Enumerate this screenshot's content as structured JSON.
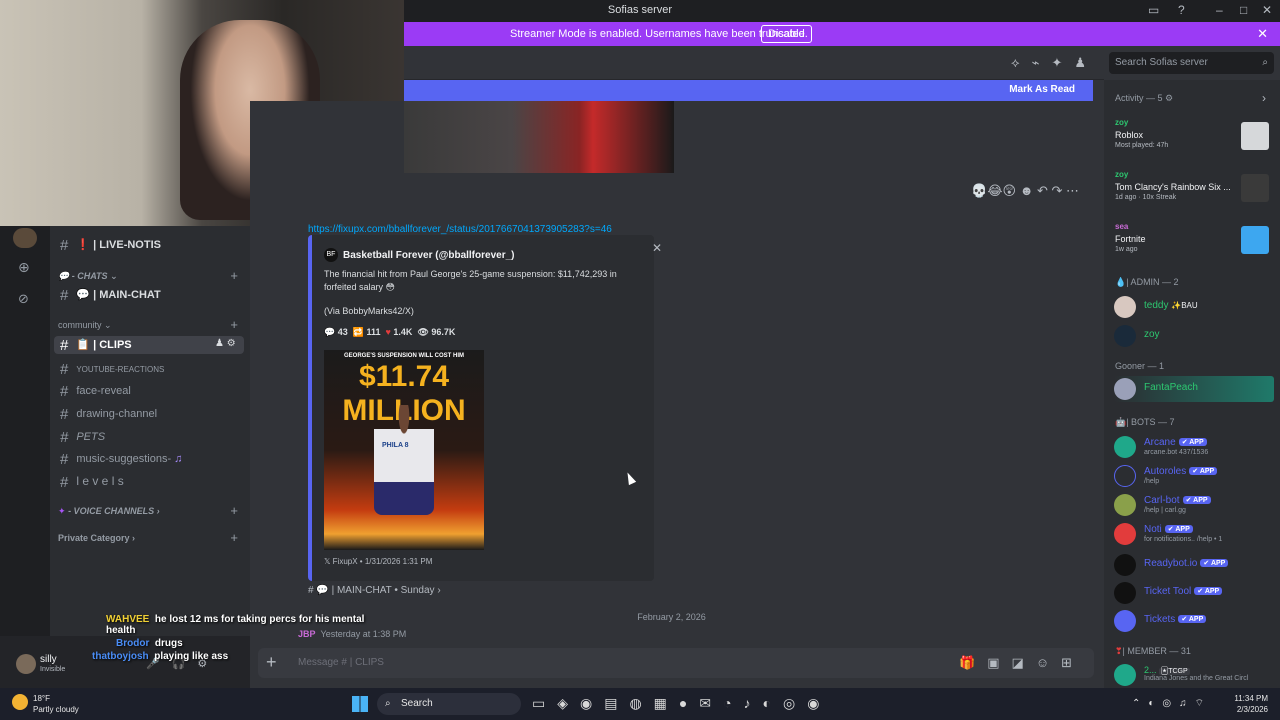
{
  "window": {
    "title": "Sofias server"
  },
  "streamer_banner": {
    "message": "Streamer Mode is enabled. Usernames have been truncated.",
    "button": "Disable"
  },
  "search": {
    "placeholder": "Search Sofias server"
  },
  "mark_read": {
    "label": "Mark As Read"
  },
  "channels": {
    "live_notis": "| LIVE-NOTIS",
    "chats_category": "- CHATS",
    "main_chat": "| MAIN-CHAT",
    "community_category": "community",
    "clips": "| CLIPS",
    "youtube_reactions": "YOUTUBE-REACTIONS",
    "face_reveal": "face-reveal",
    "drawing_channel": "drawing-channel",
    "pets": "PETS",
    "music_suggestions": "music-suggestions-",
    "levels": "l e v e l s",
    "voice_category": "- VOICE CHANNELS",
    "private_category": "Private Category"
  },
  "message": {
    "link": "https://fixupx.com/bballforever_/status/2017667041373905283?s=46",
    "embed_author": "Basketball Forever (@bballforever_)",
    "embed_avatar": "BF",
    "embed_desc": "The financial hit from Paul George's 25-game suspension: $11,742,293 in forfeited salary 😳",
    "embed_via": "(Via BobbyMarks42/X)",
    "stats": {
      "replies": "43",
      "retweets": "111",
      "likes": "1.4K",
      "views": "96.7K"
    },
    "poster_top": "GEORGE'S SUSPENSION WILL COST HIM",
    "poster_amount": "$11.74 MILLION",
    "poster_jersey": "PHILA 8",
    "footer": "FixupX • 1/31/2026 1:31 PM",
    "thread": "| MAIN-CHAT • Sunday"
  },
  "date_divider": "February 2, 2026",
  "message_preview": {
    "author": "JBP",
    "time": "Yesterday at 1:38 PM"
  },
  "composer": {
    "placeholder": "Message # | CLIPS"
  },
  "user_panel": {
    "name": "silly",
    "status": "Invisible"
  },
  "overlay_chat": [
    {
      "name": "WAHVEE",
      "text": "he lost 12 ms for taking percs for his mental health"
    },
    {
      "name": "Brodor",
      "text": "drugs"
    },
    {
      "name": "thatboyjosh",
      "text": "playing like ass"
    }
  ],
  "members": {
    "activity_header": "Activity — 5",
    "activities": [
      {
        "user": "zoy",
        "game": "Roblox",
        "sub": "Most played: 47h"
      },
      {
        "user": "zoy",
        "game": "Tom Clancy's Rainbow Six ...",
        "sub": "1d ago · 10x Streak"
      },
      {
        "user": "sea",
        "game": "Fortnite",
        "sub": "1w ago"
      }
    ],
    "admin_header": "| ADMIN — 2",
    "admins": [
      {
        "name": "teddy",
        "tag": "BAU"
      },
      {
        "name": "zoy"
      }
    ],
    "gooner_header": "Gooner — 1",
    "gooner": "FantaPeach",
    "bots_header": "| BOTS — 7",
    "bots": [
      {
        "name": "Arcane",
        "sub": "arcane.bot 437/1536"
      },
      {
        "name": "Autoroles",
        "sub": "/help"
      },
      {
        "name": "Carl-bot",
        "sub": "/help | carl.gg"
      },
      {
        "name": "Noti",
        "sub": "for notifications.. /help • 1"
      },
      {
        "name": "Readybot.io",
        "sub": ""
      },
      {
        "name": "Ticket Tool",
        "sub": ""
      },
      {
        "name": "Tickets",
        "sub": ""
      }
    ],
    "app_tag": "APP",
    "member_header": "| MEMBER — 31",
    "member_preview": {
      "name": "2...",
      "tag": "TCGP",
      "sub": "Indiana Jones and the Great Circl"
    }
  },
  "taskbar": {
    "temp": "18°F",
    "weather": "Partly cloudy",
    "search": "Search",
    "time": "11:34 PM",
    "date": "2/3/2026"
  },
  "colors": {
    "accent": "#5865f2",
    "streamer": "#9b3bf5",
    "online": "#2dc770"
  }
}
